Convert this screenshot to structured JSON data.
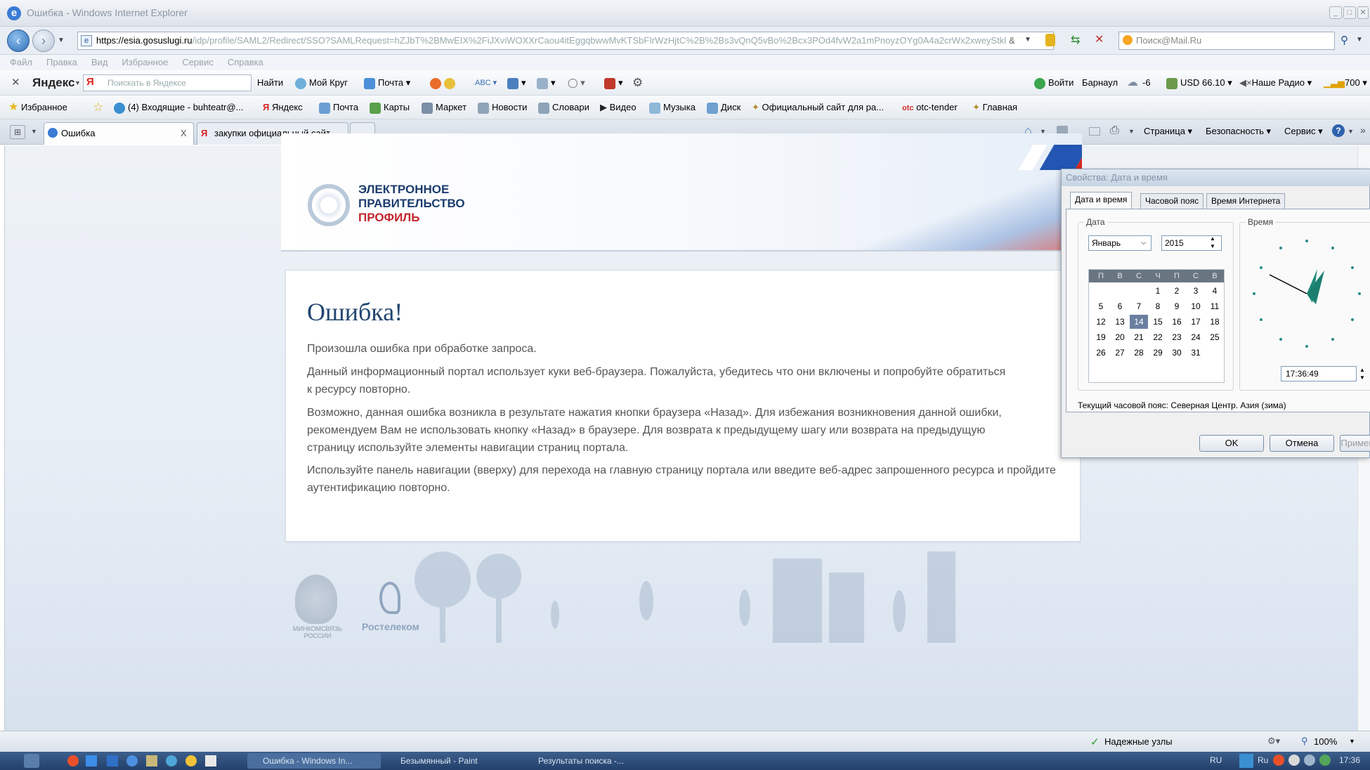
{
  "window": {
    "title": "Ошибка - Windows Internet Explorer"
  },
  "address": {
    "url_host": "https://esia.gosuslugi.ru",
    "url_path": "/idp/profile/SAML2/Redirect/SSO?SAMLRequest=hZJbT%2BMwEIX%2FiJXviWOXXrCaou4itEggqbwwMvKTSbFIrWzHjtC%2B%2Bs3vQnQ5vBo%2Bcx3POd4fvW2a1mPnoyzOYg0A4a2crWx2xweyStkl",
    "search_placeholder": "Поиск@Mail.Ru"
  },
  "menu": [
    "Файл",
    "Правка",
    "Вид",
    "Избранное",
    "Сервис",
    "Справка"
  ],
  "yandex_bar": {
    "brand": "Яндекс",
    "search_placeholder": "Поискать в Яндексе",
    "find": "Найти",
    "moy_krug": "Мой Круг",
    "mail": "Почта",
    "login": "Войти",
    "city": "Барнаул",
    "temp": "-6",
    "usd": "USD 66.10",
    "radio": "Наше Радио",
    "signal": "700"
  },
  "favorites": {
    "label": "Избранное",
    "items": [
      "(4) Входящие - buhteatr@...",
      "Яндекс",
      "Почта",
      "Карты",
      "Маркет",
      "Новости",
      "Словари",
      "Видео",
      "Музыка",
      "Диск",
      "Официальный сайт для ра...",
      "otc-tender",
      "Главная"
    ],
    "otc_badge": "otc"
  },
  "tabs": {
    "active": "Ошибка",
    "other": "закупки официальный сайт...",
    "close": "X"
  },
  "ie_cmd": {
    "page": "Страница",
    "security": "Безопасность",
    "service": "Сервис"
  },
  "site": {
    "logo_line1": "ЭЛЕКТРОННОЕ",
    "logo_line2": "ПРАВИТЕЛЬСТВО",
    "logo_line3": "ПРОФИЛЬ",
    "error_title": "Ошибка!",
    "p1": "Произошла ошибка при обработке запроса.",
    "p2": "Данный информационный портал использует куки веб-браузера. Пожалуйста, убедитесь что они включены и попробуйте обратиться к ресурсу повторно.",
    "p3": "Возможно, данная ошибка возникла в результате нажатия кнопки браузера «Назад». Для избежания возникновения данной ошибки, рекомендуем Вам не использовать кнопку «Назад» в браузере. Для возврата к предыдущему шагу или возврата на предыдущую страницу используйте элементы навигации страниц портала.",
    "p4": "Используйте панель навигации (вверху) для перехода на главную страницу портала или введите веб-адрес запрошенного ресурса и пройдите аутентификацию повторно.",
    "footer_mincom": "МИНКОМСВЯЗЬ РОССИИ",
    "footer_rt": "Ростелеком"
  },
  "dialog": {
    "title": "Свойства: Дата и время",
    "tab_datetime": "Дата и время",
    "tab_tz": "Часовой пояс",
    "tab_inet": "Время Интернета",
    "date_group": "Дата",
    "time_group": "Время",
    "month": "Январь",
    "year": "2015",
    "weekdays": [
      "П",
      "В",
      "С",
      "Ч",
      "П",
      "С",
      "В"
    ],
    "weeks": [
      [
        "",
        "",
        "",
        "1",
        "2",
        "3",
        "4"
      ],
      [
        "5",
        "6",
        "7",
        "8",
        "9",
        "10",
        "11"
      ],
      [
        "12",
        "13",
        "14",
        "15",
        "16",
        "17",
        "18"
      ],
      [
        "19",
        "20",
        "21",
        "22",
        "23",
        "24",
        "25"
      ],
      [
        "26",
        "27",
        "28",
        "29",
        "30",
        "31",
        ""
      ]
    ],
    "selected_day": "14",
    "time": "17:36:49",
    "tz_text": "Текущий часовой пояс: Северная Центр. Азия (зима)",
    "ok": "OK",
    "cancel": "Отмена",
    "apply": "Примен"
  },
  "status": {
    "trusted": "Надежные узлы",
    "zoom": "100%"
  },
  "taskbar": {
    "task1": "Ошибка - Windows In...",
    "task2": "Безымянный - Paint",
    "task3": "Результаты поиска -...",
    "lang": "RU",
    "kbd": "Ru",
    "clock": "17:36"
  },
  "colors": {
    "accent_blue": "#23456e",
    "flag_red": "#d52b1e",
    "flag_blue": "#0039a6"
  }
}
